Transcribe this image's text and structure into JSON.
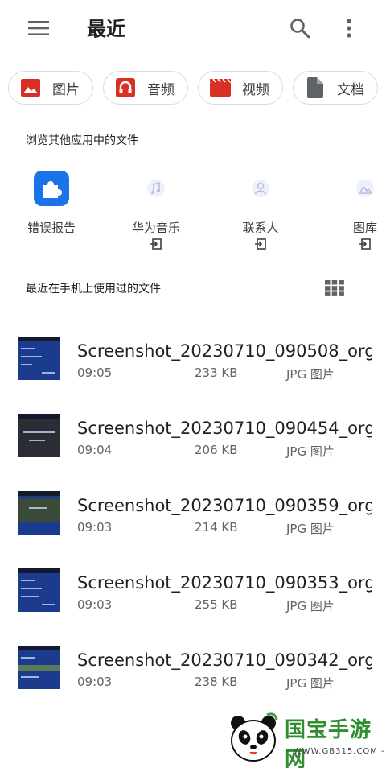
{
  "header": {
    "title": "最近",
    "menu_icon": "menu-icon",
    "search_icon": "search-icon",
    "more_icon": "more-vert-icon"
  },
  "chips": [
    {
      "label": "图片",
      "icon": "image-icon",
      "color": "#d93025"
    },
    {
      "label": "音频",
      "icon": "headphones-icon",
      "color": "#d93025"
    },
    {
      "label": "视频",
      "icon": "video-icon",
      "color": "#d93025"
    },
    {
      "label": "文档",
      "icon": "document-icon",
      "color": "#5f6368"
    }
  ],
  "other_apps": {
    "title": "浏览其他应用中的文件",
    "items": [
      {
        "name": "错误报告",
        "icon": "puzzle-icon",
        "color": "#1a73e8"
      },
      {
        "name": "华为音乐",
        "icon": "music-app-icon",
        "open_icon": "open-in-app-icon"
      },
      {
        "name": "联系人",
        "icon": "contacts-app-icon",
        "open_icon": "open-in-app-icon"
      },
      {
        "name": "图库",
        "icon": "gallery-app-icon",
        "open_icon": "open-in-app-icon"
      }
    ]
  },
  "recent": {
    "title": "最近在手机上使用过的文件",
    "grid_icon": "grid-view-icon",
    "files": [
      {
        "name": "Screenshot_20230710_090508_org....",
        "time": "09:05",
        "size": "233 KB",
        "type": "JPG 图片"
      },
      {
        "name": "Screenshot_20230710_090454_org....",
        "time": "09:04",
        "size": "206 KB",
        "type": "JPG 图片"
      },
      {
        "name": "Screenshot_20230710_090359_org....",
        "time": "09:03",
        "size": "214 KB",
        "type": "JPG 图片"
      },
      {
        "name": "Screenshot_20230710_090353_org....",
        "time": "09:03",
        "size": "255 KB",
        "type": "JPG 图片"
      },
      {
        "name": "Screenshot_20230710_090342_org....",
        "time": "09:03",
        "size": "238 KB",
        "type": "JPG 图片"
      }
    ]
  },
  "watermark": {
    "text": "国宝手游网",
    "url": "- WWW.GB315.COM -"
  }
}
